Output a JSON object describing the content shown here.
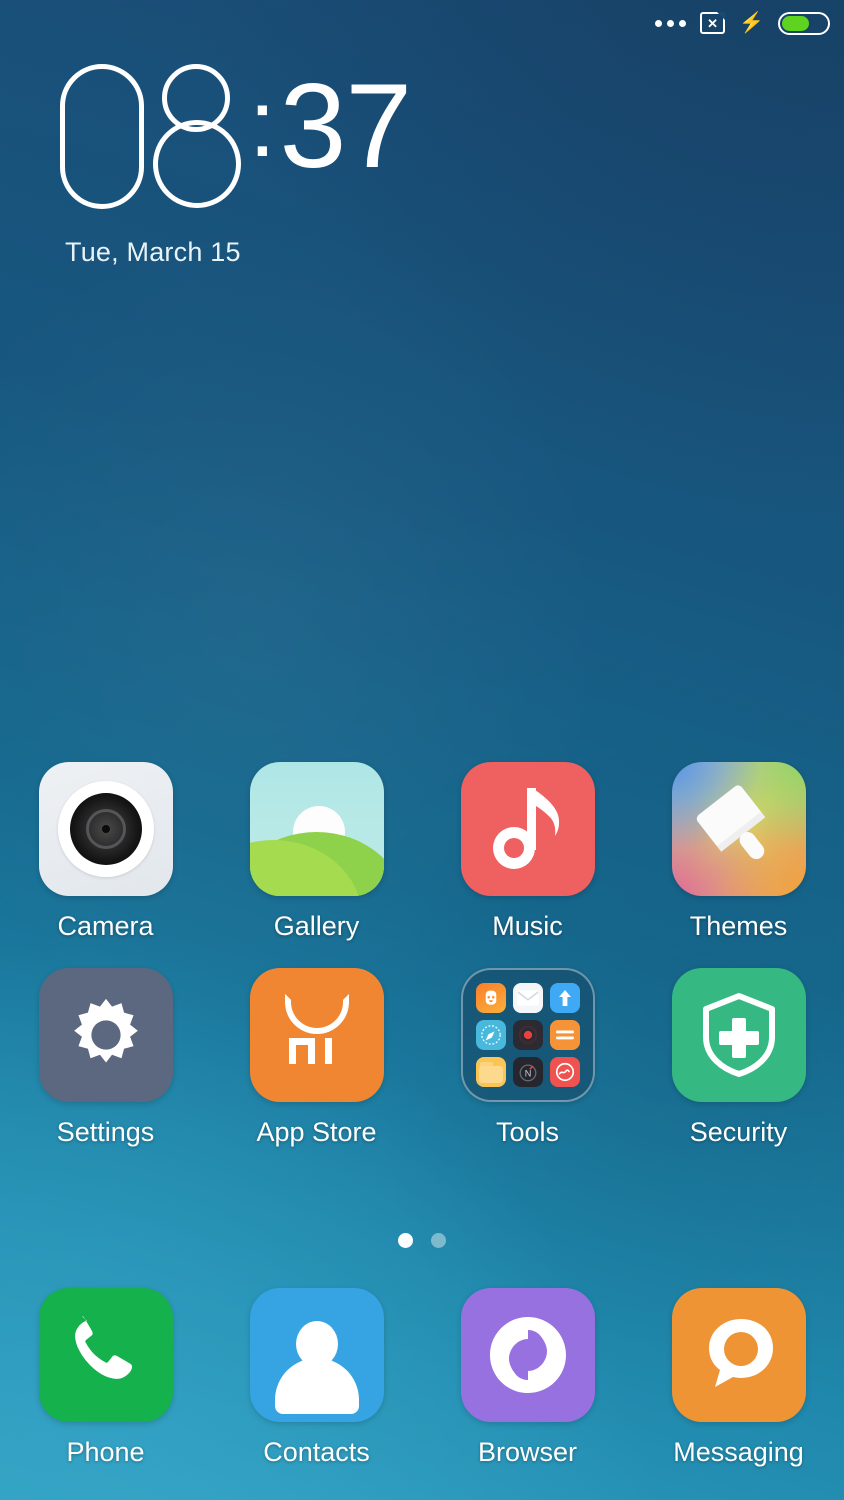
{
  "statusbar": {
    "overflow_icon": "more-dots-icon",
    "sim_icon": "no-sim-card-icon",
    "sim_glyph": "✕",
    "charging_icon": "charging-bolt-icon",
    "charging_glyph": "⚡",
    "battery_icon": "battery-icon",
    "battery_level_percent": 62,
    "battery_fill_color": "#5ed320"
  },
  "clock": {
    "hours": "08",
    "hour_digit_1": "0",
    "hour_digit_2": "8",
    "separator": ":",
    "minutes": "37",
    "date": "Tue, March 15"
  },
  "home": {
    "apps": [
      {
        "label": "Camera",
        "icon": "camera-icon",
        "color": "#e8ecf0"
      },
      {
        "label": "Gallery",
        "icon": "gallery-icon",
        "color": "#a5db4e"
      },
      {
        "label": "Music",
        "icon": "music-note-icon",
        "color": "#ef6060"
      },
      {
        "label": "Themes",
        "icon": "paintbrush-icon",
        "color": "#d9d26a"
      },
      {
        "label": "Settings",
        "icon": "gear-icon",
        "color": "#5c6880"
      },
      {
        "label": "App Store",
        "icon": "shopping-bag-mi-icon",
        "color": "#f08631",
        "logo_text": "mi"
      },
      {
        "label": "Tools",
        "icon": "folder-icon",
        "color": "#164664"
      },
      {
        "label": "Security",
        "icon": "shield-plus-icon",
        "color": "#35b881"
      }
    ],
    "folder_tools_items": [
      "mi-video-icon",
      "mail-icon",
      "updater-arrow-icon",
      "compass-icon",
      "recorder-icon",
      "notes-icon",
      "file-explorer-icon",
      "n-compass-icon",
      "scanner-icon"
    ],
    "page_dots": {
      "count": 2,
      "active_index": 0
    }
  },
  "dock": {
    "apps": [
      {
        "label": "Phone",
        "icon": "phone-handset-icon",
        "color": "#14b14c"
      },
      {
        "label": "Contacts",
        "icon": "person-icon",
        "color": "#36a3e2"
      },
      {
        "label": "Browser",
        "icon": "browser-swirl-icon",
        "color": "#9871e0"
      },
      {
        "label": "Messaging",
        "icon": "speech-bubble-icon",
        "color": "#ef9434"
      }
    ]
  },
  "theme": {
    "wallpaper_top": "#1b4a74",
    "wallpaper_bottom": "#2c9cbf",
    "label_color": "#ffffff"
  }
}
